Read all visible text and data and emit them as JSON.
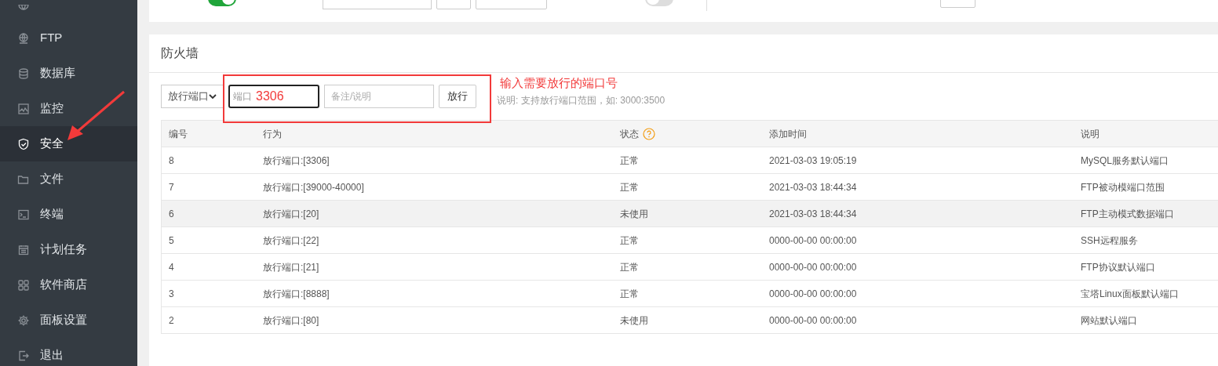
{
  "sidebar": {
    "items": [
      {
        "label": "FTP",
        "selected": false
      },
      {
        "label": "数据库",
        "selected": false
      },
      {
        "label": "监控",
        "selected": false
      },
      {
        "label": "安全",
        "selected": true
      },
      {
        "label": "文件",
        "selected": false
      },
      {
        "label": "终端",
        "selected": false
      },
      {
        "label": "计划任务",
        "selected": false
      },
      {
        "label": "软件商店",
        "selected": false
      },
      {
        "label": "面板设置",
        "selected": false
      },
      {
        "label": "退出",
        "selected": false
      }
    ]
  },
  "top_panel": {
    "ssh_on": true,
    "ping_on": false
  },
  "firewall": {
    "title": "防火墙",
    "rule_type": "放行端口",
    "port_field": {
      "placeholder": "端口",
      "value": "3306"
    },
    "note_field": {
      "placeholder": "备注/说明"
    },
    "submit_button": "放行",
    "hint": "说明: 支持放行端口范围，如: 3000:3500",
    "annotation": "输入需要放行的端口号",
    "table": {
      "columns": [
        "编号",
        "行为",
        "状态",
        "添加时间",
        "说明"
      ],
      "rows": [
        {
          "cells": [
            "8",
            "放行端口:[3306]",
            "正常",
            "2021-03-03 19:05:19",
            "MySQL服务默认端口"
          ],
          "selected": false
        },
        {
          "cells": [
            "7",
            "放行端口:[39000-40000]",
            "正常",
            "2021-03-03 18:44:34",
            "FTP被动模端口范围"
          ],
          "selected": false
        },
        {
          "cells": [
            "6",
            "放行端口:[20]",
            "未使用",
            "2021-03-03 18:44:34",
            "FTP主动模式数据端口"
          ],
          "selected": true
        },
        {
          "cells": [
            "5",
            "放行端口:[22]",
            "正常",
            "0000-00-00 00:00:00",
            "SSH远程服务"
          ],
          "selected": false
        },
        {
          "cells": [
            "4",
            "放行端口:[21]",
            "正常",
            "0000-00-00 00:00:00",
            "FTP协议默认端口"
          ],
          "selected": false
        },
        {
          "cells": [
            "3",
            "放行端口:[8888]",
            "正常",
            "0000-00-00 00:00:00",
            "宝塔Linux面板默认端口"
          ],
          "selected": false
        },
        {
          "cells": [
            "2",
            "放行端口:[80]",
            "未使用",
            "0000-00-00 00:00:00",
            "网站默认端口"
          ],
          "selected": false
        }
      ]
    }
  }
}
